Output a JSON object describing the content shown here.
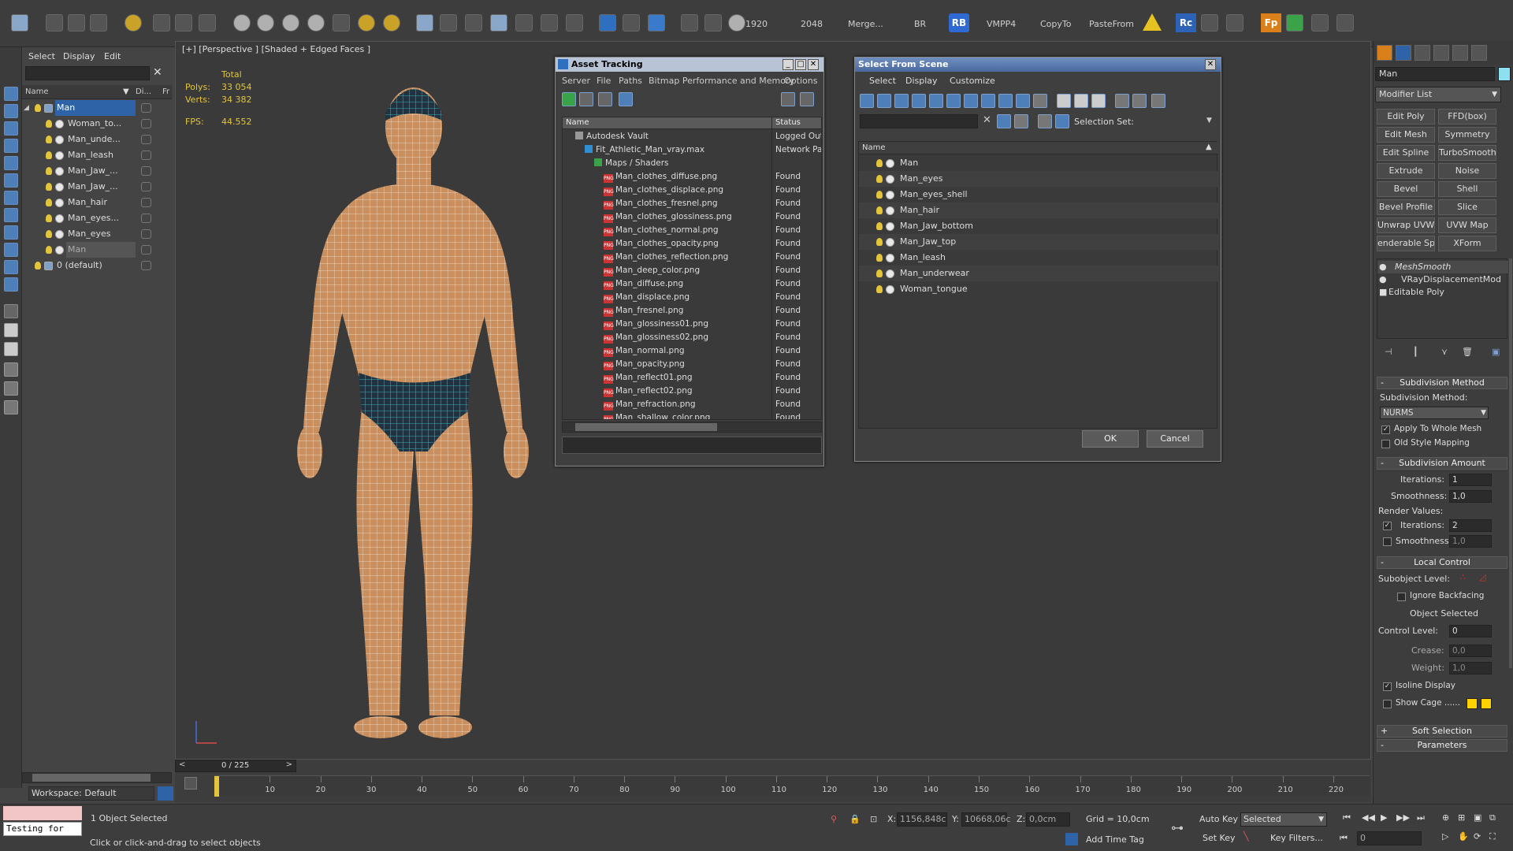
{
  "toolbar": {
    "res_w": "1920",
    "res_h": "2048",
    "merge": "Merge...",
    "br": "BR",
    "rb": "RB",
    "vmpp4": "VMPP4",
    "copyto": "CopyTo",
    "pastefrom": "PasteFrom",
    "rc": "Rc",
    "fp": "Fp"
  },
  "scene": {
    "menu": [
      "Select",
      "Display",
      "Edit"
    ],
    "col_name": "Name",
    "col_display": "Di...",
    "col_fr": "Fr",
    "items": [
      {
        "label": "Man",
        "depth": 0,
        "kind": "group",
        "state": "selected"
      },
      {
        "label": "Woman_to...",
        "depth": 1,
        "kind": "object",
        "state": ""
      },
      {
        "label": "Man_unde...",
        "depth": 1,
        "kind": "object",
        "state": ""
      },
      {
        "label": "Man_leash",
        "depth": 1,
        "kind": "object",
        "state": ""
      },
      {
        "label": "Man_Jaw_...",
        "depth": 1,
        "kind": "object",
        "state": ""
      },
      {
        "label": "Man_Jaw_...",
        "depth": 1,
        "kind": "object",
        "state": ""
      },
      {
        "label": "Man_hair",
        "depth": 1,
        "kind": "object",
        "state": ""
      },
      {
        "label": "Man_eyes...",
        "depth": 1,
        "kind": "object",
        "state": ""
      },
      {
        "label": "Man_eyes",
        "depth": 1,
        "kind": "object",
        "state": ""
      },
      {
        "label": "Man",
        "depth": 1,
        "kind": "object",
        "state": "dim"
      },
      {
        "label": "0 (default)",
        "depth": 0,
        "kind": "layer",
        "state": ""
      }
    ],
    "workspace": "Workspace: Default"
  },
  "viewport": {
    "label": "[+] [Perspective ] [Shaded + Edged Faces ]",
    "stats_total": "Total",
    "polys_label": "Polys:",
    "polys_value": "33 054",
    "verts_label": "Verts:",
    "verts_value": "34 382",
    "fps_label": "FPS:",
    "fps_value": "44.552"
  },
  "asset_tracking": {
    "title": "Asset Tracking",
    "menu": [
      "Server",
      "File",
      "Paths",
      "Bitmap Performance and Memory",
      "Options"
    ],
    "col_name": "Name",
    "col_status": "Status",
    "rows": [
      {
        "name": "Autodesk Vault",
        "status": "Logged Out",
        "depth": 1,
        "icon": "vault"
      },
      {
        "name": "Fit_Athletic_Man_vray.max",
        "status": "Network Pa",
        "depth": 2,
        "icon": "max"
      },
      {
        "name": "Maps / Shaders",
        "status": "",
        "depth": 3,
        "icon": "map"
      },
      {
        "name": "Man_clothes_diffuse.png",
        "status": "Found",
        "depth": 4,
        "icon": "png"
      },
      {
        "name": "Man_clothes_displace.png",
        "status": "Found",
        "depth": 4,
        "icon": "png"
      },
      {
        "name": "Man_clothes_fresnel.png",
        "status": "Found",
        "depth": 4,
        "icon": "png"
      },
      {
        "name": "Man_clothes_glossiness.png",
        "status": "Found",
        "depth": 4,
        "icon": "png"
      },
      {
        "name": "Man_clothes_normal.png",
        "status": "Found",
        "depth": 4,
        "icon": "png"
      },
      {
        "name": "Man_clothes_opacity.png",
        "status": "Found",
        "depth": 4,
        "icon": "png"
      },
      {
        "name": "Man_clothes_reflection.png",
        "status": "Found",
        "depth": 4,
        "icon": "png"
      },
      {
        "name": "Man_deep_color.png",
        "status": "Found",
        "depth": 4,
        "icon": "png"
      },
      {
        "name": "Man_diffuse.png",
        "status": "Found",
        "depth": 4,
        "icon": "png"
      },
      {
        "name": "Man_displace.png",
        "status": "Found",
        "depth": 4,
        "icon": "png"
      },
      {
        "name": "Man_fresnel.png",
        "status": "Found",
        "depth": 4,
        "icon": "png"
      },
      {
        "name": "Man_glossiness01.png",
        "status": "Found",
        "depth": 4,
        "icon": "png"
      },
      {
        "name": "Man_glossiness02.png",
        "status": "Found",
        "depth": 4,
        "icon": "png"
      },
      {
        "name": "Man_normal.png",
        "status": "Found",
        "depth": 4,
        "icon": "png"
      },
      {
        "name": "Man_opacity.png",
        "status": "Found",
        "depth": 4,
        "icon": "png"
      },
      {
        "name": "Man_reflect01.png",
        "status": "Found",
        "depth": 4,
        "icon": "png"
      },
      {
        "name": "Man_reflect02.png",
        "status": "Found",
        "depth": 4,
        "icon": "png"
      },
      {
        "name": "Man_refraction.png",
        "status": "Found",
        "depth": 4,
        "icon": "png"
      },
      {
        "name": "Man_shallow_color.png",
        "status": "Found",
        "depth": 4,
        "icon": "png"
      }
    ]
  },
  "select_from_scene": {
    "title": "Select From Scene",
    "menu": [
      "Select",
      "Display",
      "Customize"
    ],
    "selection_set": "Selection Set:",
    "col_name": "Name",
    "items": [
      "Man",
      "Man_eyes",
      "Man_eyes_shell",
      "Man_hair",
      "Man_Jaw_bottom",
      "Man_Jaw_top",
      "Man_leash",
      "Man_underwear",
      "Woman_tongue"
    ],
    "ok": "OK",
    "cancel": "Cancel"
  },
  "command_panel": {
    "object_name": "Man",
    "object_color": "#8de0ef",
    "modifier_list": "Modifier List",
    "modifier_buttons": [
      "Edit Poly",
      "FFD(box)",
      "Edit Mesh",
      "Symmetry",
      "Edit Spline",
      "TurboSmooth",
      "Extrude",
      "Noise",
      "Bevel",
      "Shell",
      "Bevel Profile",
      "Slice",
      "Unwrap UVW",
      "UVW Map",
      "enderable Splir",
      "XForm"
    ],
    "stack": [
      "MeshSmooth",
      "VRayDisplacementMod",
      "Editable Poly"
    ],
    "subdivision_method_header": "Subdivision Method",
    "subdivision_method_label": "Subdivision Method:",
    "subdivision_method_value": "NURMS",
    "apply_whole_mesh": "Apply To Whole Mesh",
    "old_style_mapping": "Old Style Mapping",
    "subdivision_amount_header": "Subdivision Amount",
    "iterations_label": "Iterations:",
    "iterations_value": "1",
    "smoothness_label": "Smoothness:",
    "smoothness_value": "1,0",
    "render_values": "Render Values:",
    "render_iterations_value": "2",
    "render_smoothness_value": "1,0",
    "local_control_header": "Local Control",
    "subobject_level": "Subobject Level:",
    "ignore_backfacing": "Ignore Backfacing",
    "object_selected": "Object Selected",
    "control_level_label": "Control Level:",
    "control_level_value": "0",
    "crease_label": "Crease:",
    "crease_value": "0,0",
    "weight_label": "Weight:",
    "weight_value": "1,0",
    "isoline_display": "Isoline Display",
    "show_cage": "Show Cage ......",
    "soft_selection_header": "Soft Selection",
    "parameters_header": "Parameters"
  },
  "timeline": {
    "frame_counter": "0 / 225",
    "ticks": [
      "10",
      "20",
      "30",
      "40",
      "50",
      "60",
      "70",
      "80",
      "90",
      "100",
      "110",
      "120",
      "130",
      "140",
      "150",
      "160",
      "170",
      "180",
      "190",
      "200",
      "210",
      "220"
    ]
  },
  "status": {
    "maxscript": "Testing for",
    "selected_count": "1 Object Selected",
    "prompt": "Click or click-and-drag to select objects",
    "x_label": "X:",
    "x_value": "1156,848c",
    "y_label": "Y:",
    "y_value": "10668,06c",
    "z_label": "Z:",
    "z_value": "0,0cm",
    "grid": "Grid = 10,0cm",
    "add_time_tag": "Add Time Tag",
    "auto_key": "Auto Key",
    "set_key": "Set Key",
    "key_mode": "Selected",
    "key_filters": "Key Filters...",
    "frame_value": "0"
  },
  "colors": {
    "accent": "#2f63a8",
    "wire_skin": "#c98f5e",
    "wire_selection": "#3fd0e0",
    "found": "#dddddd"
  }
}
